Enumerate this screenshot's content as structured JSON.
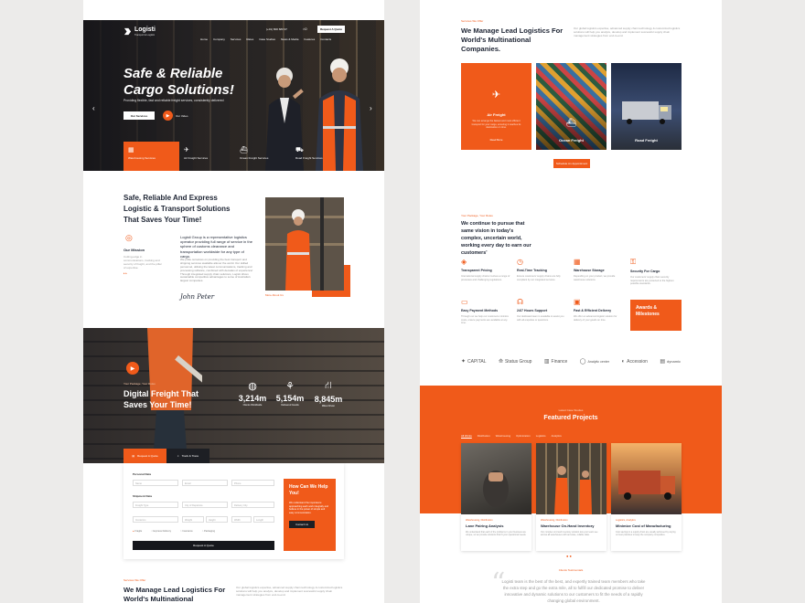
{
  "colors": {
    "accent": "#f05a1a",
    "dark": "#15171c",
    "page_bg": "#ecebea"
  },
  "left": {
    "brand": {
      "name": "Logisti",
      "tagline": "Transport & Logistic"
    },
    "header": {
      "contact": "(+01) 800 680 97",
      "cart_icon": "bag-icon",
      "cart_count": "0",
      "quote_button": "Request A Quote",
      "menu": [
        "Home",
        "Company",
        "Services",
        "Rates",
        "Case Studies",
        "News & Media",
        "Features",
        "Contacts"
      ]
    },
    "hero": {
      "title": "Safe & Reliable Cargo Solutions!",
      "subtitle": "Providing flexible, fast and reliable freight services, consistently delivered",
      "primary_button": "Our Services",
      "video_label": "Our Video"
    },
    "services": [
      {
        "icon": "warehouse-icon",
        "label": "Warehousing Services"
      },
      {
        "icon": "airplane-icon",
        "label": "Air Freight Services"
      },
      {
        "icon": "ship-icon",
        "label": "Ocean Freight Services"
      },
      {
        "icon": "truck-icon",
        "label": "Road Freight Services"
      }
    ],
    "about": {
      "heading": "Safe, Reliable And Express Logistic & Transport Solutions That Saves Your Time!",
      "mission_title": "Our Mission",
      "mission_text": "Cutting-edge in communications, tracking and security of freight, and the pillar of expertise.",
      "lead": "Logisti Group is a representative logistics operator providing full range of service in the sphere of customs clearance and transportation worldwide for any type of cargo.",
      "body": "We pride ourselves on providing the best transport and shipping services available allover the world. Our skilled personnel, utilising the latest communications, tracking and processing software, combined with decades of experience! Through integrated supply chain solutions, Logisti drives sustainable competitive advantages to some of Australia's largest companies.",
      "signature": "John Peter",
      "more_link": "More About Us"
    },
    "freight": {
      "subtitle": "Your Package, Your Rules",
      "title": "Digital Freight That Saves Your Time!",
      "stats": [
        {
          "icon": "globe-icon",
          "value": "3,214m",
          "label": "Clients Worldwide"
        },
        {
          "icon": "plant-icon",
          "value": "5,154m",
          "label": "Delivered Goods"
        },
        {
          "icon": "road-icon",
          "value": "8,845m",
          "label": "Miles Driven"
        }
      ],
      "tabs": [
        "Request A Quote",
        "Track & Trace"
      ]
    },
    "form": {
      "personal_label": "Personal Data",
      "personal_fields": [
        "Name",
        "Email",
        "Phone"
      ],
      "shipment_label": "Shipment Data",
      "shipment_fields": [
        "Freight Type",
        "City of Departure",
        "Delivery City"
      ],
      "dimension_fields": [
        "Incoterms",
        "Weight",
        "Height",
        "Width",
        "Length"
      ],
      "options": [
        "Fragile",
        "Express Delivery",
        "Insurance",
        "Packaging"
      ],
      "submit": "Request A Quote",
      "help_title": "How Can We Help You!",
      "help_text": "We understand the importance approaching each work integrally and believe in the power of simple and easy communication.",
      "help_button": "Contact Us"
    },
    "bottom": {
      "subtitle": "Services We Offer",
      "heading": "We Manage Lead Logistics For World's Multinational",
      "text": "Our global logistics expertise, advanced supply chain technology & customized logistics solutions will help you analyze, develop and implement successful supply chain management strategies from end-to-end."
    }
  },
  "right": {
    "intro": {
      "subtitle": "Services We Offer",
      "heading": "We Manage Lead Logistics For World's Multinational Companies.",
      "text": "Our global logistics expertise, advanced supply chain technology & customized logistics solutions will help you analyze, develop and implement successful supply chain management strategies from end-to-end."
    },
    "tiles": [
      {
        "icon": "airplane-icon",
        "label": "Air Freight",
        "text": "We can arrange the fastest and most efficient transport for your cargo, ensuring it reaches its destination on time.",
        "link": "Read More"
      },
      {
        "icon": "ship-icon",
        "label": "Ocean Freight"
      },
      {
        "icon": "truck-icon",
        "label": "Road Freight"
      }
    ],
    "appointment_button": "Schedule An Appointment",
    "package": {
      "subtitle": "Your Package, Your Rules",
      "heading": "We continue to pursue that same vision in today's complex, uncertain world, working every day to earn our customers'"
    },
    "features": [
      {
        "icon": "transparent-icon",
        "title": "Transparent Pricing",
        "text": "International supply chains involves a range of processes and challenging regulations."
      },
      {
        "icon": "clock-icon",
        "title": "Real-Time Tracking",
        "text": "Ensure customers' supply chains are fully compliant by our integrated services."
      },
      {
        "icon": "warehouse-icon",
        "title": "Warehouse Storage",
        "text": "Depending on your product, we provide warehouse solutions."
      },
      {
        "icon": "lock-icon",
        "title": "Security For Cargo",
        "text": "Our customers' supply chain security requirements are protected to the highest possible standards."
      },
      {
        "icon": "card-icon",
        "title": "Easy Payment Methods",
        "text": "Through our we help our customers minimize costs, ensure payments are available at any time."
      },
      {
        "icon": "headset-icon",
        "title": "24/7 Hours Support",
        "text": "Our dedicated team is available to assist you with all enquiries or questions."
      },
      {
        "icon": "box-icon",
        "title": "Fast & Efficient Delivery",
        "text": "We offer an advanced logistic solution for delivery of your goods on time."
      }
    ],
    "awards": "Awards & Milestones",
    "brands": [
      "CAPITAL",
      "Status Group",
      "Finance",
      "Analytic center",
      "Accession",
      "dynamic"
    ],
    "featured": {
      "subtitle": "Latest Case Studies",
      "heading": "Featured Projects",
      "tabs": [
        "All Works",
        "Distribution",
        "Warehousing",
        "Optimization",
        "Logistics",
        "Analytics"
      ],
      "projects": [
        {
          "category": "Warehousing, Distribution",
          "name": "Lane Pairing Analysis",
          "text": "We understand that each of the problems in your business are unique, so we provide solutions that fit your operational needs."
        },
        {
          "category": "Warehousing, Distribution",
          "name": "Warehouse On-Hand Inventory",
          "text": "Our complex on-hand inventory solution lets your team see across all warehouses with accurate, reliable data."
        },
        {
          "category": "Logistics, Analytics",
          "name": "Minimize Cost of Manufacturing",
          "text": "Cost savings in a supply chain are usually achieved by relying on best practices to keep the company competitive."
        }
      ]
    },
    "testimonial": {
      "subtitle": "Clients Testimonials",
      "text": "Logisti team is the best of the best, and expertly trained team members who take the extra step and go the extra mile, all to fulfill our dedicated promise to deliver innovative and dynamic solutions to our customers to fit the needs of a rapidly changing global environment."
    }
  }
}
